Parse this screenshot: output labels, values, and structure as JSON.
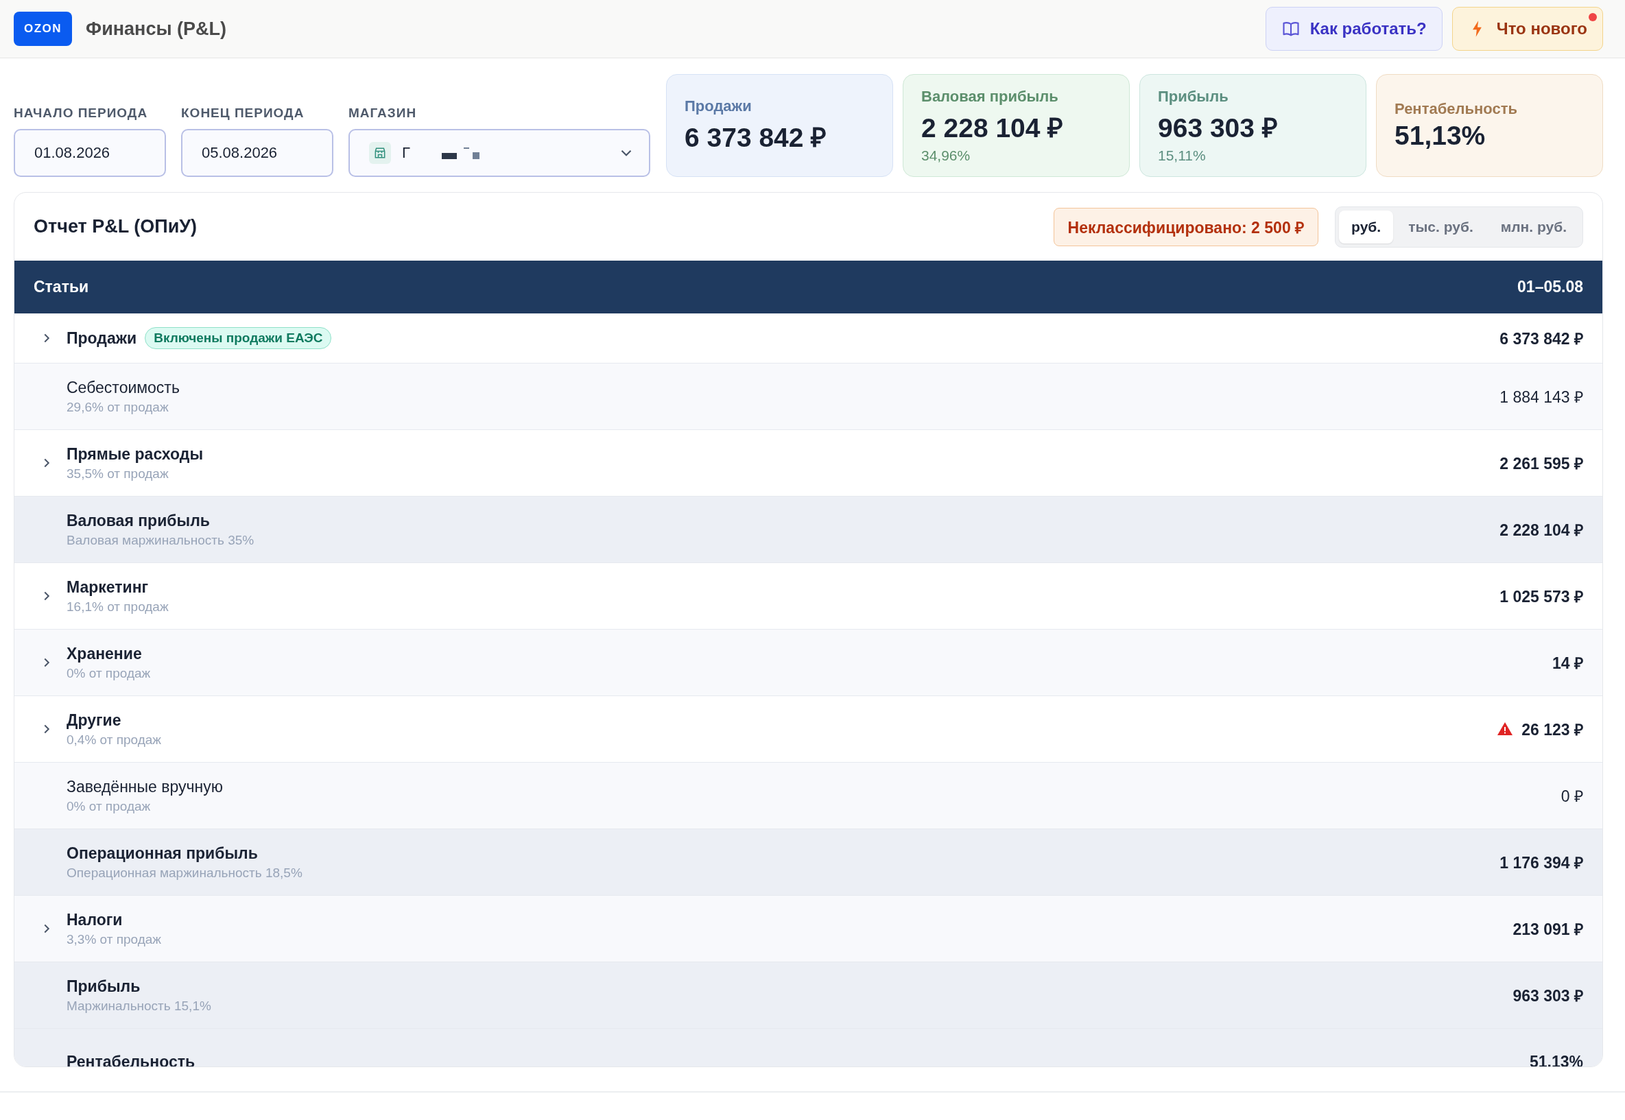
{
  "app": {
    "logo": "OZON",
    "title": "Финансы (P&L)"
  },
  "header_buttons": [
    {
      "kind": "help",
      "label": "Как работать?",
      "badge": false
    },
    {
      "kind": "news",
      "label": "Что нового",
      "badge": true
    }
  ],
  "filters": [
    {
      "label": "НАЧАЛО ПЕРИОДА",
      "value": "01.08.2026",
      "kind": "date"
    },
    {
      "label": "КОНЕЦ ПЕРИОДА",
      "value": "05.08.2026",
      "kind": "date"
    },
    {
      "label": "МАГАЗИН",
      "value": "Г",
      "kind": "store"
    }
  ],
  "kpi_cards": [
    {
      "kind": "sales",
      "label": "Продажи",
      "value": "6 373 842 ₽"
    },
    {
      "kind": "gross",
      "label": "Валовая прибыль",
      "value": "2 228 104 ₽",
      "sub": "34,96%"
    },
    {
      "kind": "profit",
      "label": "Прибыль",
      "value": "963 303 ₽",
      "sub": "15,11%"
    },
    {
      "kind": "rent",
      "label": "Рентабельность",
      "value": "51,13%"
    }
  ],
  "report": {
    "title": "Отчет P&L (ОПиУ)",
    "unclassified": "Неклассифицировано: 2 500 ₽",
    "units": [
      {
        "label": "руб.",
        "selected": true
      },
      {
        "label": "тыс. руб.",
        "selected": false
      },
      {
        "label": "млн. руб.",
        "selected": false
      }
    ],
    "columns": [
      "Статьи",
      "01–05.08"
    ],
    "rows": [
      {
        "kind": "item",
        "label": "Продажи",
        "bold": true,
        "expandable": true,
        "badge": "Включены продажи ЕАЭС",
        "value": "6 373 842 ₽",
        "warning": false
      },
      {
        "kind": "item",
        "label": "Себестоимость",
        "bold": false,
        "expandable": false,
        "sub": "29,6% от продаж",
        "value": "1 884 143 ₽",
        "warning": false
      },
      {
        "kind": "item",
        "label": "Прямые расходы",
        "bold": true,
        "expandable": true,
        "sub": "35,5% от продаж",
        "value": "2 261 595 ₽",
        "warning": false
      },
      {
        "kind": "total",
        "label": "Валовая прибыль",
        "bold": true,
        "expandable": false,
        "sub": "Валовая маржинальность 35%",
        "value": "2 228 104 ₽",
        "warning": false
      },
      {
        "kind": "item",
        "label": "Маркетинг",
        "bold": true,
        "expandable": true,
        "sub": "16,1% от продаж",
        "value": "1 025 573 ₽",
        "warning": false
      },
      {
        "kind": "item",
        "label": "Хранение",
        "bold": true,
        "expandable": true,
        "sub": "0% от продаж",
        "value": "14 ₽",
        "warning": false
      },
      {
        "kind": "item",
        "label": "Другие",
        "bold": true,
        "expandable": true,
        "sub": "0,4% от продаж",
        "value": "26 123 ₽",
        "warning": true
      },
      {
        "kind": "item",
        "label": "Заведённые вручную",
        "bold": false,
        "expandable": false,
        "sub": "0% от продаж",
        "value": "0 ₽",
        "warning": false
      },
      {
        "kind": "total",
        "label": "Операционная прибыль",
        "bold": true,
        "expandable": false,
        "sub": "Операционная маржинальность 18,5%",
        "value": "1 176 394 ₽",
        "warning": false
      },
      {
        "kind": "item",
        "label": "Налоги",
        "bold": true,
        "expandable": true,
        "sub": "3,3% от продаж",
        "value": "213 091 ₽",
        "warning": false
      },
      {
        "kind": "total",
        "label": "Прибыль",
        "bold": true,
        "expandable": false,
        "sub": "Маржинальность 15,1%",
        "value": "963 303 ₽",
        "warning": false
      },
      {
        "kind": "total",
        "label": "Рентабельность",
        "bold": true,
        "expandable": false,
        "value": "51.13%",
        "warning": false
      }
    ]
  }
}
